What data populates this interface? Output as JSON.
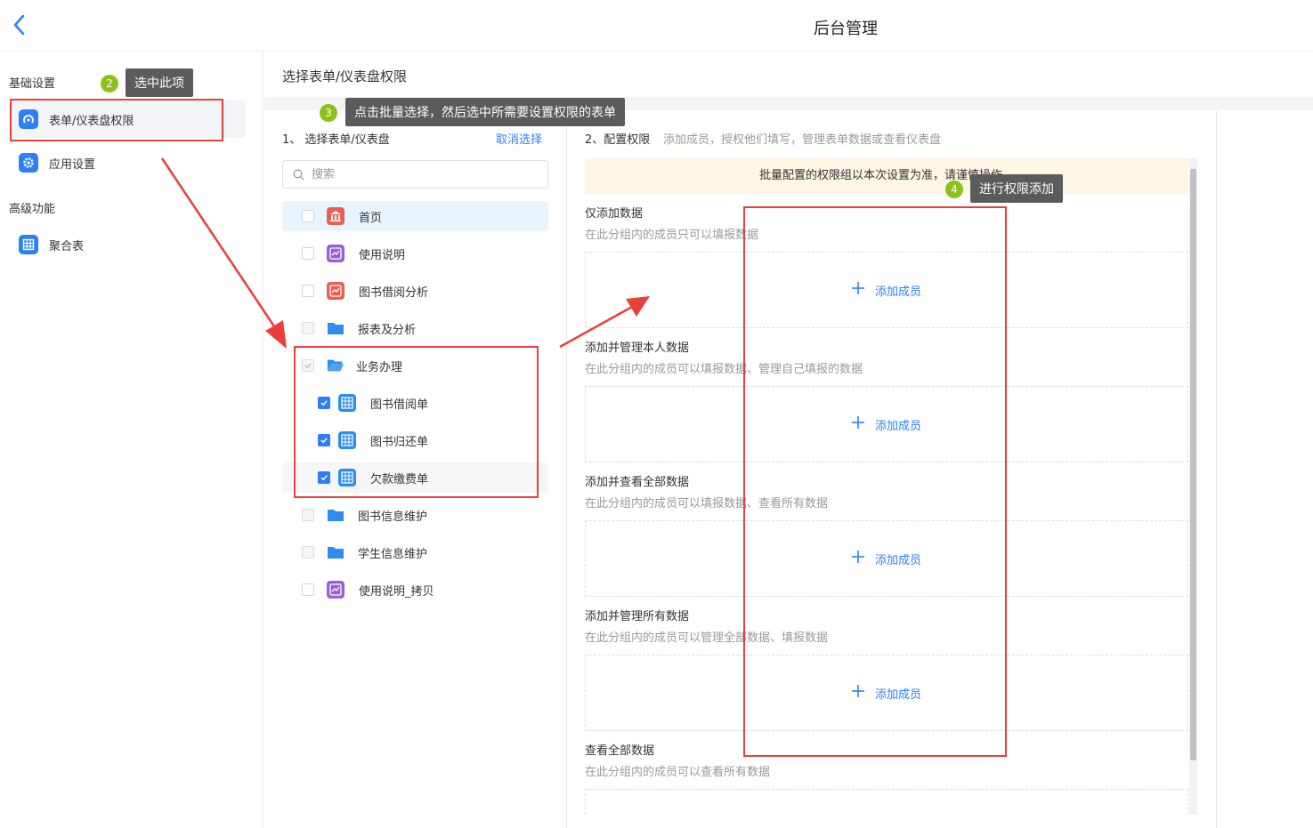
{
  "header": {
    "title": "后台管理"
  },
  "sidebar": {
    "groups": [
      {
        "label": "基础设置"
      },
      {
        "label": "高级功能"
      }
    ],
    "items": [
      {
        "label": "表单/仪表盘权限",
        "icon": "permission-icon",
        "active": true,
        "color": "#2d7ff9"
      },
      {
        "label": "应用设置",
        "icon": "gear-icon",
        "color": "#2d7ff9"
      },
      {
        "label": "聚合表",
        "icon": "table-icon",
        "color": "#2d7ff9"
      }
    ]
  },
  "panel": {
    "title": "选择表单/仪表盘权限"
  },
  "left": {
    "step_label": "1、 选择表单/仪表盘",
    "cancel_label": "取消选择",
    "search_placeholder": "搜索",
    "rows": [
      {
        "label": "首页",
        "icon": "home-icon",
        "checked": false
      },
      {
        "label": "使用说明",
        "icon": "dashboard-icon",
        "checked": false
      },
      {
        "label": "图书借阅分析",
        "icon": "chart-icon",
        "checked": false
      },
      {
        "label": "报表及分析",
        "icon": "folder-icon",
        "checked": false
      },
      {
        "label": "业务办理",
        "icon": "folder-open-icon",
        "checked": "partial"
      },
      {
        "label": "图书借阅单",
        "icon": "form-icon",
        "checked": true
      },
      {
        "label": "图书归还单",
        "icon": "form-icon",
        "checked": true
      },
      {
        "label": "欠款缴费单",
        "icon": "form-icon",
        "checked": true
      },
      {
        "label": "图书信息维护",
        "icon": "folder-icon",
        "checked": false
      },
      {
        "label": "学生信息维护",
        "icon": "folder-icon",
        "checked": false
      },
      {
        "label": "使用说明_拷贝",
        "icon": "dashboard-icon",
        "checked": false
      }
    ]
  },
  "right": {
    "step_label": "2、配置权限",
    "step_desc": "添加成员，授权他们填写，管理表单数据或查看仪表盘",
    "warning": "批量配置的权限组以本次设置为准，请谨慎操作。",
    "add_label": "添加成员",
    "groups": [
      {
        "title": "仅添加数据",
        "desc": "在此分组内的成员只可以填报数据"
      },
      {
        "title": "添加并管理本人数据",
        "desc": "在此分组内的成员可以填报数据、管理自己填报的数据"
      },
      {
        "title": "添加并查看全部数据",
        "desc": "在此分组内的成员可以填报数据、查看所有数据"
      },
      {
        "title": "添加并管理所有数据",
        "desc": "在此分组内的成员可以管理全部数据、填报数据"
      },
      {
        "title": "查看全部数据",
        "desc": "在此分组内的成员可以查看所有数据"
      }
    ]
  },
  "annotations": {
    "tip2": {
      "num": "2",
      "text": "选中此项"
    },
    "tip3": {
      "num": "3",
      "text": "点击批量选择，然后选中所需要设置权限的表单"
    },
    "tip4": {
      "num": "4",
      "text": "进行权限添加"
    }
  },
  "colors": {
    "accent": "#2d7ff9",
    "annotation_red": "#e8403a",
    "badge_green": "#8bc21a",
    "warn_bg": "#fdf6e4"
  }
}
